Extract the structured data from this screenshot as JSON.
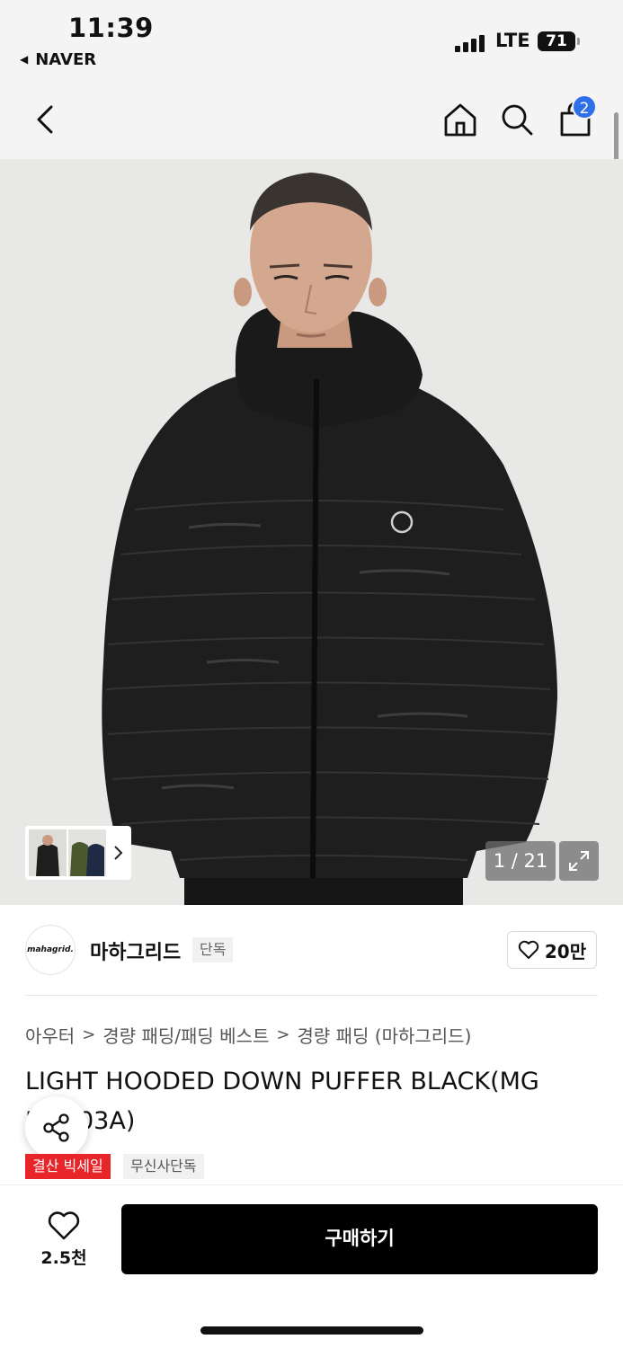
{
  "status_bar": {
    "time": "11:39",
    "back_app": "NAVER",
    "network": "LTE",
    "battery": "71"
  },
  "nav": {
    "cart_count": "2"
  },
  "hero": {
    "image_counter": "1 / 21"
  },
  "brand": {
    "logo_text": "mahagrid.",
    "name": "마하그리드",
    "exclusive_label": "단독",
    "likes": "20만"
  },
  "breadcrumb": [
    "아우터",
    "경량 패딩/패딩 베스트",
    "경량 패딩 (마하그리드)"
  ],
  "product": {
    "title": "LIGHT HOODED DOWN PUFFER BLACK(MG    MB903A)",
    "badges": [
      "결산 빅세일",
      "무신사단독"
    ]
  },
  "bottom": {
    "wish_count": "2.5천",
    "buy_label": "구매하기"
  },
  "colors": {
    "accent_blue": "#2f6fea",
    "sale_red": "#e8262a",
    "buy_black": "#000000"
  }
}
